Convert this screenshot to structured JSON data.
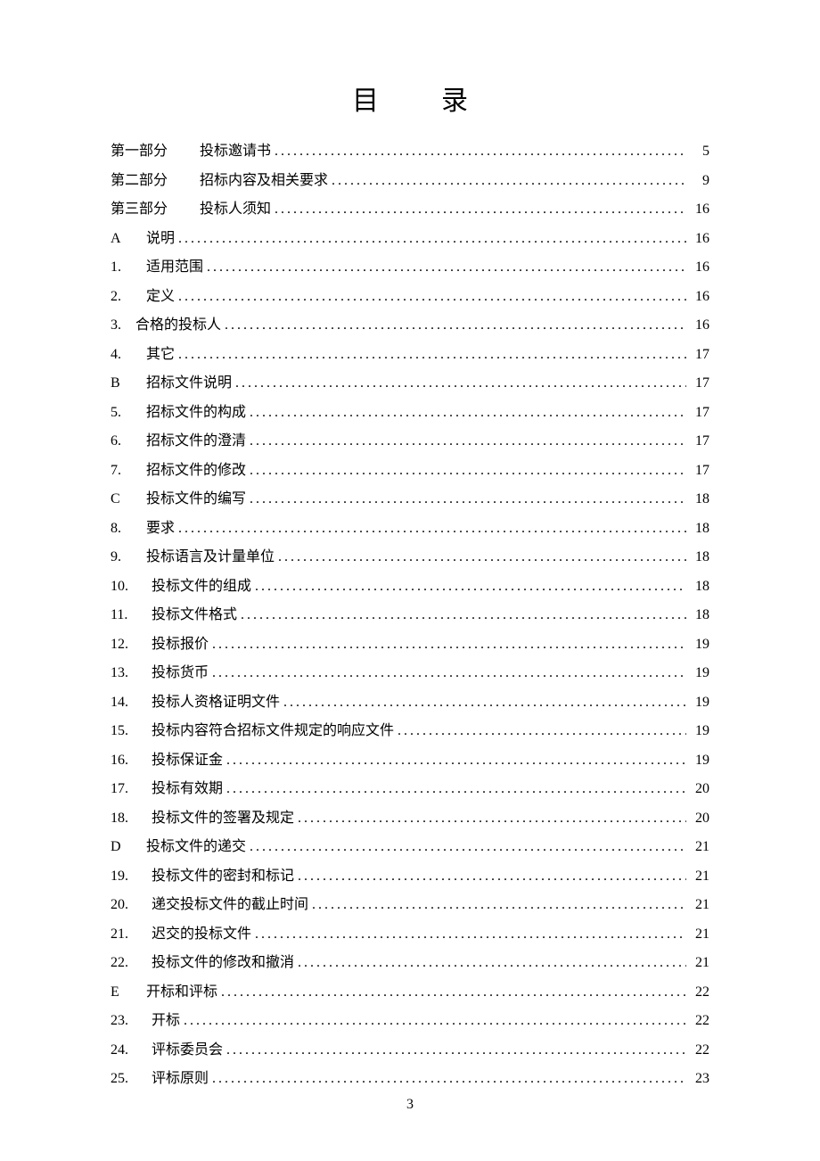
{
  "title": "目录",
  "page_number": "3",
  "entries": [
    {
      "label": "第一部分",
      "label_class": "label-part",
      "title": "投标邀请书",
      "page": "5"
    },
    {
      "label": "第二部分",
      "label_class": "label-part",
      "title": "招标内容及相关要求",
      "page": "9"
    },
    {
      "label": "第三部分",
      "label_class": "label-part",
      "title": "投标人须知",
      "page": "16"
    },
    {
      "label": "A",
      "label_class": "label-alpha",
      "title": "说明",
      "page": "16"
    },
    {
      "label": "1.",
      "label_class": "label-num1",
      "title": "适用范围",
      "page": "16"
    },
    {
      "label": "2.",
      "label_class": "label-num1",
      "title": "定义",
      "page": "16"
    },
    {
      "label": "3.",
      "label_class": "label-num3",
      "title": "合格的投标人",
      "page": "16"
    },
    {
      "label": "4.",
      "label_class": "label-num1",
      "title": "其它",
      "page": "17"
    },
    {
      "label": "B",
      "label_class": "label-alpha",
      "title": "招标文件说明",
      "page": "17"
    },
    {
      "label": "5.",
      "label_class": "label-num1",
      "title": "招标文件的构成",
      "page": "17"
    },
    {
      "label": "6.",
      "label_class": "label-num1",
      "title": "招标文件的澄清",
      "page": "17"
    },
    {
      "label": "7.",
      "label_class": "label-num1",
      "title": "招标文件的修改",
      "page": "17"
    },
    {
      "label": "C",
      "label_class": "label-alpha",
      "title": "投标文件的编写",
      "page": "18"
    },
    {
      "label": "8.",
      "label_class": "label-num1",
      "title": "要求",
      "page": "18"
    },
    {
      "label": "9.",
      "label_class": "label-num1",
      "title": "投标语言及计量单位",
      "page": "18"
    },
    {
      "label": "10.",
      "label_class": "label-num2",
      "title": "投标文件的组成",
      "page": "18"
    },
    {
      "label": "11.",
      "label_class": "label-num2",
      "title": "投标文件格式",
      "page": "18"
    },
    {
      "label": "12.",
      "label_class": "label-num2",
      "title": "投标报价",
      "page": "19"
    },
    {
      "label": "13.",
      "label_class": "label-num2",
      "title": "投标货币",
      "page": "19"
    },
    {
      "label": "14.",
      "label_class": "label-num2",
      "title": "投标人资格证明文件",
      "page": "19"
    },
    {
      "label": "15.",
      "label_class": "label-num2",
      "title": "投标内容符合招标文件规定的响应文件",
      "page": "19"
    },
    {
      "label": "16.",
      "label_class": "label-num2",
      "title": "投标保证金",
      "page": "19"
    },
    {
      "label": "17.",
      "label_class": "label-num2",
      "title": "投标有效期",
      "page": "20"
    },
    {
      "label": "18.",
      "label_class": "label-num2",
      "title": "投标文件的签署及规定",
      "page": "20"
    },
    {
      "label": "D",
      "label_class": "label-alpha",
      "title": "投标文件的递交",
      "page": "21"
    },
    {
      "label": "19.",
      "label_class": "label-num2",
      "title": "投标文件的密封和标记",
      "page": "21"
    },
    {
      "label": "20.",
      "label_class": "label-num2",
      "title": "递交投标文件的截止时间",
      "page": "21"
    },
    {
      "label": "21.",
      "label_class": "label-num2",
      "title": "迟交的投标文件",
      "page": "21"
    },
    {
      "label": "22.",
      "label_class": "label-num2",
      "title": "投标文件的修改和撤消",
      "page": "21"
    },
    {
      "label": "E",
      "label_class": "label-alpha",
      "title": "开标和评标",
      "page": "22"
    },
    {
      "label": "23.",
      "label_class": "label-num2",
      "title": "开标",
      "page": "22"
    },
    {
      "label": "24.",
      "label_class": "label-num2",
      "title": "评标委员会",
      "page": "22"
    },
    {
      "label": "25.",
      "label_class": "label-num2",
      "title": "评标原则",
      "page": "23"
    }
  ]
}
